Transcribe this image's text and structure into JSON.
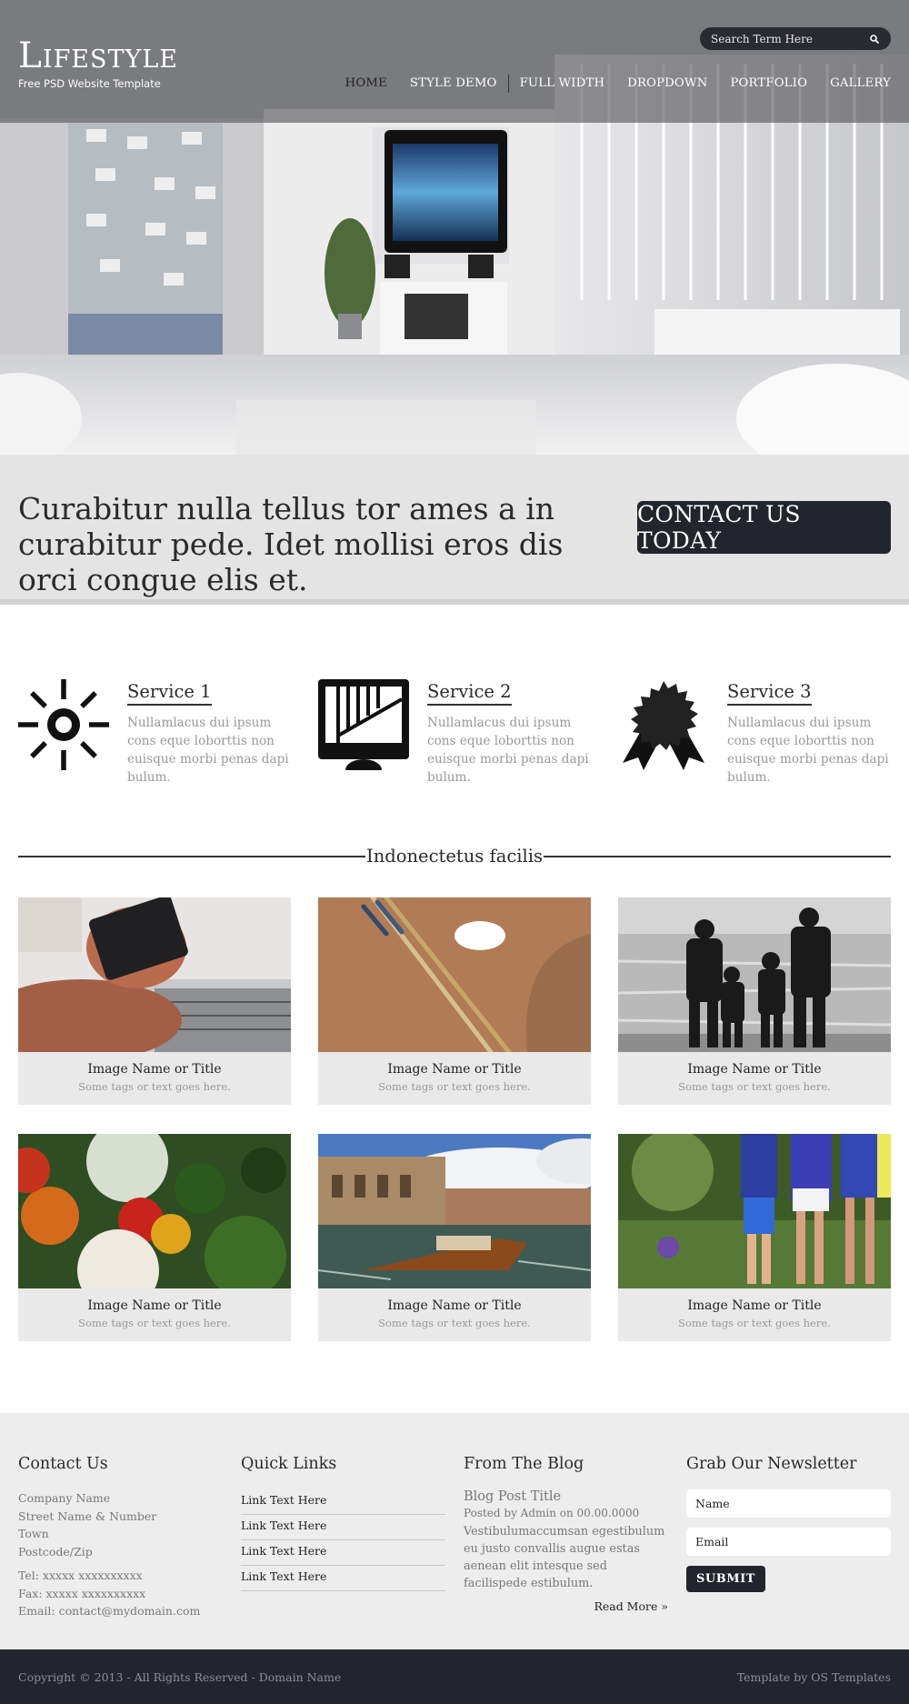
{
  "header": {
    "logo_title": "Lifestyle",
    "logo_subtitle": "Free PSD Website Template",
    "search_placeholder": "Search Term Here",
    "nav": [
      "HOME",
      "STYLE DEMO",
      "FULL WIDTH",
      "DROPDOWN",
      "PORTFOLIO",
      "GALLERY"
    ]
  },
  "cta": {
    "text": "Curabitur nulla tellus tor ames a in curabitur pede. Idet mollisi eros dis orci congue elis et.",
    "button": "CONTACT US TODAY"
  },
  "services": [
    {
      "title": "Service 1",
      "text": "Nullamlacus dui ipsum cons eque loborttis non euisque morbi penas dapi bulum.",
      "icon": "sun-icon"
    },
    {
      "title": "Service 2",
      "text": "Nullamlacus dui ipsum cons eque loborttis non euisque morbi penas dapi bulum.",
      "icon": "monitor-icon"
    },
    {
      "title": "Service 3",
      "text": "Nullamlacus dui ipsum cons eque loborttis non euisque morbi penas dapi bulum.",
      "icon": "award-icon"
    }
  ],
  "gallery": {
    "title": "Indonectetus facilis",
    "items": [
      {
        "caption": "Image Name or Title",
        "tags": "Some tags or text goes here."
      },
      {
        "caption": "Image Name or Title",
        "tags": "Some tags or text goes here."
      },
      {
        "caption": "Image Name or Title",
        "tags": "Some tags or text goes here."
      },
      {
        "caption": "Image Name or Title",
        "tags": "Some tags or text goes here."
      },
      {
        "caption": "Image Name or Title",
        "tags": "Some tags or text goes here."
      },
      {
        "caption": "Image Name or Title",
        "tags": "Some tags or text goes here."
      }
    ]
  },
  "footer": {
    "contact": {
      "title": "Contact Us",
      "lines": [
        "Company Name",
        "Street Name & Number",
        "Town",
        "Postcode/Zip"
      ],
      "tel": "Tel: xxxxx xxxxxxxxxx",
      "fax": "Fax: xxxxx xxxxxxxxxx",
      "email": "Email: contact@mydomain.com"
    },
    "quick_links": {
      "title": "Quick Links",
      "links": [
        "Link Text Here",
        "Link Text Here",
        "Link Text Here",
        "Link Text Here"
      ]
    },
    "blog": {
      "title": "From The Blog",
      "post_title": "Blog Post Title",
      "meta": "Posted by Admin on 00.00.0000",
      "body": "Vestibulumaccumsan egestibulum eu justo convallis augue estas aenean elit intesque sed facilispede estibulum.",
      "read_more": "Read More »"
    },
    "newsletter": {
      "title": "Grab Our Newsletter",
      "name_placeholder": "Name",
      "email_placeholder": "Email",
      "submit": "SUBMIT"
    }
  },
  "copyright": {
    "left": "Copyright © 2013 - All Rights Reserved - Domain Name",
    "right": "Template by OS Templates"
  },
  "colors": {
    "dark": "#23252d",
    "cta_bg": "#e4e4e4",
    "footer_bg": "#ededed"
  }
}
